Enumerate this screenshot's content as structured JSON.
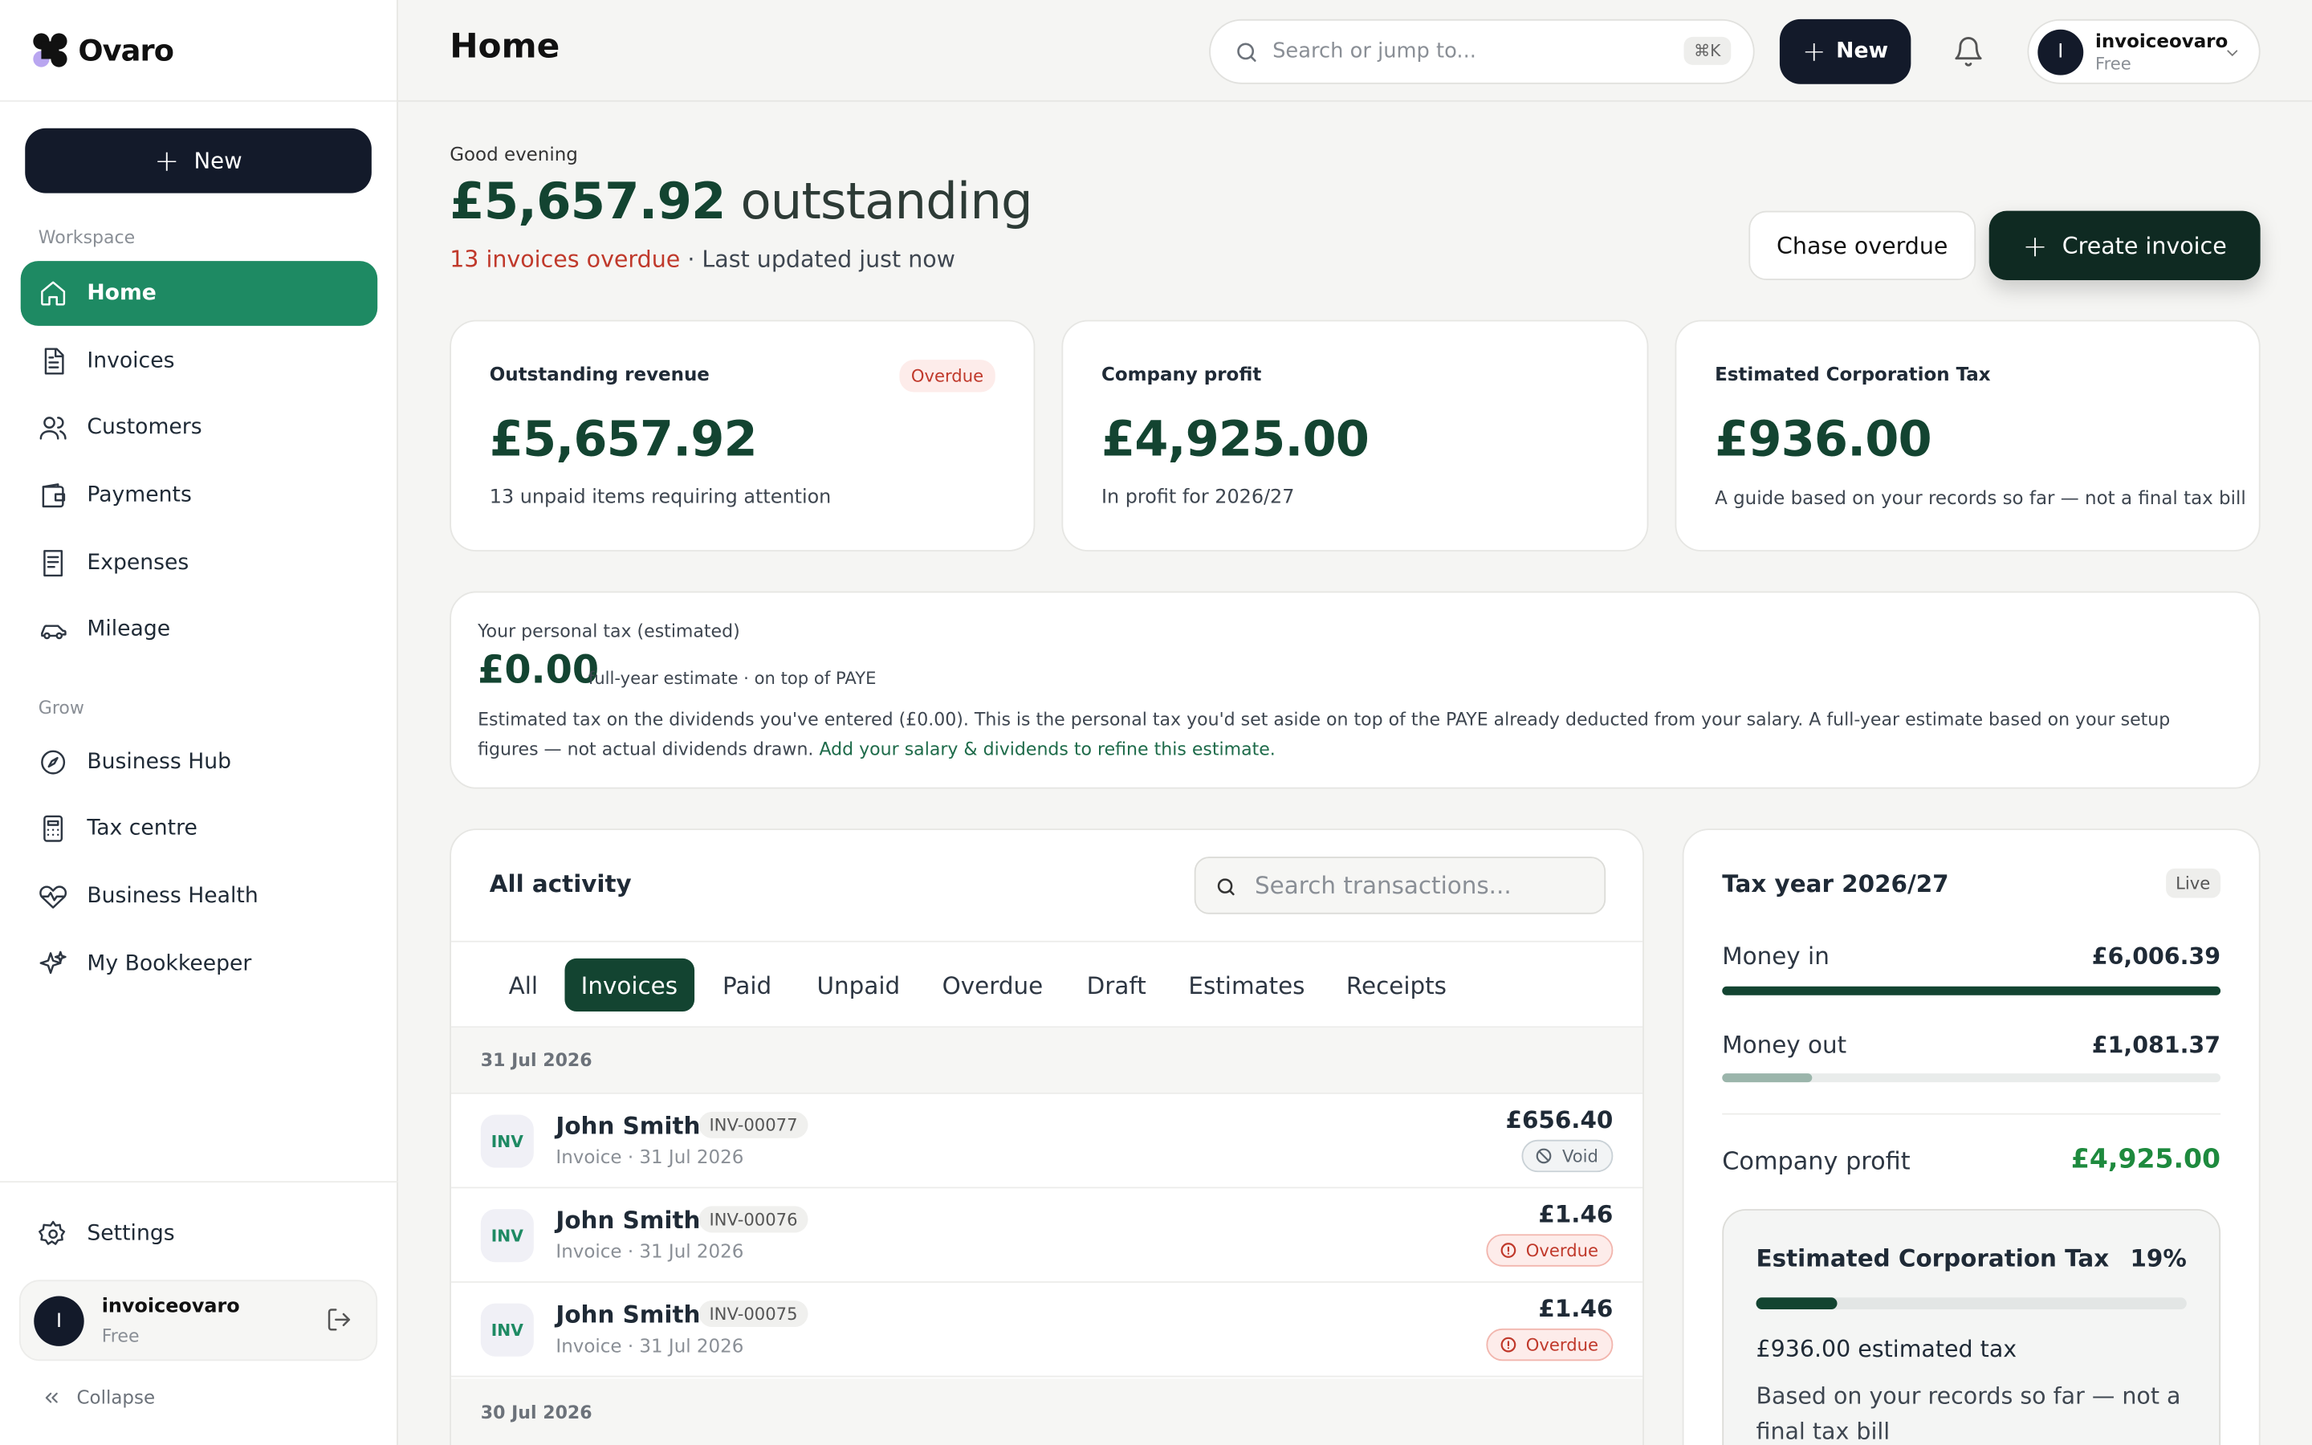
{
  "app": {
    "brand": "Ovaro"
  },
  "sidebar": {
    "new_label": "New",
    "section_workspace": "Workspace",
    "section_grow": "Grow",
    "items": [
      {
        "label": "Home",
        "icon": "home-icon"
      },
      {
        "label": "Invoices",
        "icon": "document-icon"
      },
      {
        "label": "Customers",
        "icon": "users-icon"
      },
      {
        "label": "Payments",
        "icon": "wallet-icon"
      },
      {
        "label": "Expenses",
        "icon": "receipt-icon"
      },
      {
        "label": "Mileage",
        "icon": "car-icon"
      },
      {
        "label": "Business Hub",
        "icon": "compass-icon"
      },
      {
        "label": "Tax centre",
        "icon": "calculator-icon"
      },
      {
        "label": "Business Health",
        "icon": "heart-pulse-icon"
      },
      {
        "label": "My Bookkeeper",
        "icon": "sparkles-icon"
      }
    ],
    "settings_label": "Settings",
    "user": {
      "initial": "I",
      "name": "invoiceovaro",
      "plan": "Free"
    },
    "collapse_label": "Collapse"
  },
  "topbar": {
    "title": "Home",
    "search_placeholder": "Search or jump to...",
    "search_shortcut": "⌘K",
    "new_label": "New",
    "account": {
      "initial": "I",
      "name": "invoiceovaro",
      "plan": "Free"
    }
  },
  "hero": {
    "greeting": "Good evening",
    "amount": "£5,657.92",
    "amount_suffix": "outstanding",
    "overdue_text": "13 invoices overdue",
    "updated_text": "· Last updated just now",
    "chase_label": "Chase overdue",
    "create_label": "Create invoice"
  },
  "stats": [
    {
      "label": "Outstanding revenue",
      "value": "£5,657.92",
      "desc": "13 unpaid items requiring attention",
      "badge": "Overdue"
    },
    {
      "label": "Company profit",
      "value": "£4,925.00",
      "desc": "In profit for 2026/27"
    },
    {
      "label": "Estimated Corporation Tax",
      "value": "£936.00",
      "desc": "A guide based on your records so far — not a final tax bill"
    }
  ],
  "personal_tax": {
    "label": "Your personal tax (estimated)",
    "value": "£0.00",
    "note": "full-year estimate · on top of PAYE",
    "desc": "Estimated tax on the dividends you've entered (£0.00). This is the personal tax you'd set aside on top of the PAYE already deducted from your salary. A full-year estimate based on your setup figures — not actual dividends drawn.",
    "link": "Add your salary & dividends to refine this estimate."
  },
  "activity": {
    "title": "All activity",
    "search_placeholder": "Search transactions...",
    "tabs": [
      "All",
      "Invoices",
      "Paid",
      "Unpaid",
      "Overdue",
      "Draft",
      "Estimates",
      "Receipts"
    ],
    "active_tab": "Invoices",
    "groups": [
      {
        "date": "31 Jul 2026",
        "rows": [
          {
            "badge": "INV",
            "name": "John Smith",
            "code": "INV-00077",
            "sub": "Invoice · 31 Jul 2026",
            "amount": "£656.40",
            "status": "Void"
          },
          {
            "badge": "INV",
            "name": "John Smith",
            "code": "INV-00076",
            "sub": "Invoice · 31 Jul 2026",
            "amount": "£1.46",
            "status": "Overdue"
          },
          {
            "badge": "INV",
            "name": "John Smith",
            "code": "INV-00075",
            "sub": "Invoice · 31 Jul 2026",
            "amount": "£1.46",
            "status": "Overdue"
          }
        ]
      },
      {
        "date": "30 Jul 2026",
        "rows": []
      }
    ]
  },
  "tax_year": {
    "title": "Tax year 2026/27",
    "badge": "Live",
    "money_in_label": "Money in",
    "money_in": "£6,006.39",
    "money_in_fraction": 1.0,
    "money_out_label": "Money out",
    "money_out": "£1,081.37",
    "money_out_fraction": 0.18,
    "profit_label": "Company profit",
    "profit": "£4,925.00",
    "ect": {
      "title": "Estimated Corporation Tax",
      "rate": "19%",
      "rate_fraction": 0.19,
      "amount": "£936.00 estimated tax",
      "desc": "Based on your records so far — not a final tax bill"
    },
    "colors": {
      "in": "#134431",
      "out": "#9bb5ab",
      "ect": "#134431"
    }
  },
  "colors": {
    "accent": "#1e8a63",
    "dark": "#131a2a",
    "brand_green": "#134431",
    "danger": "#c0392b"
  }
}
